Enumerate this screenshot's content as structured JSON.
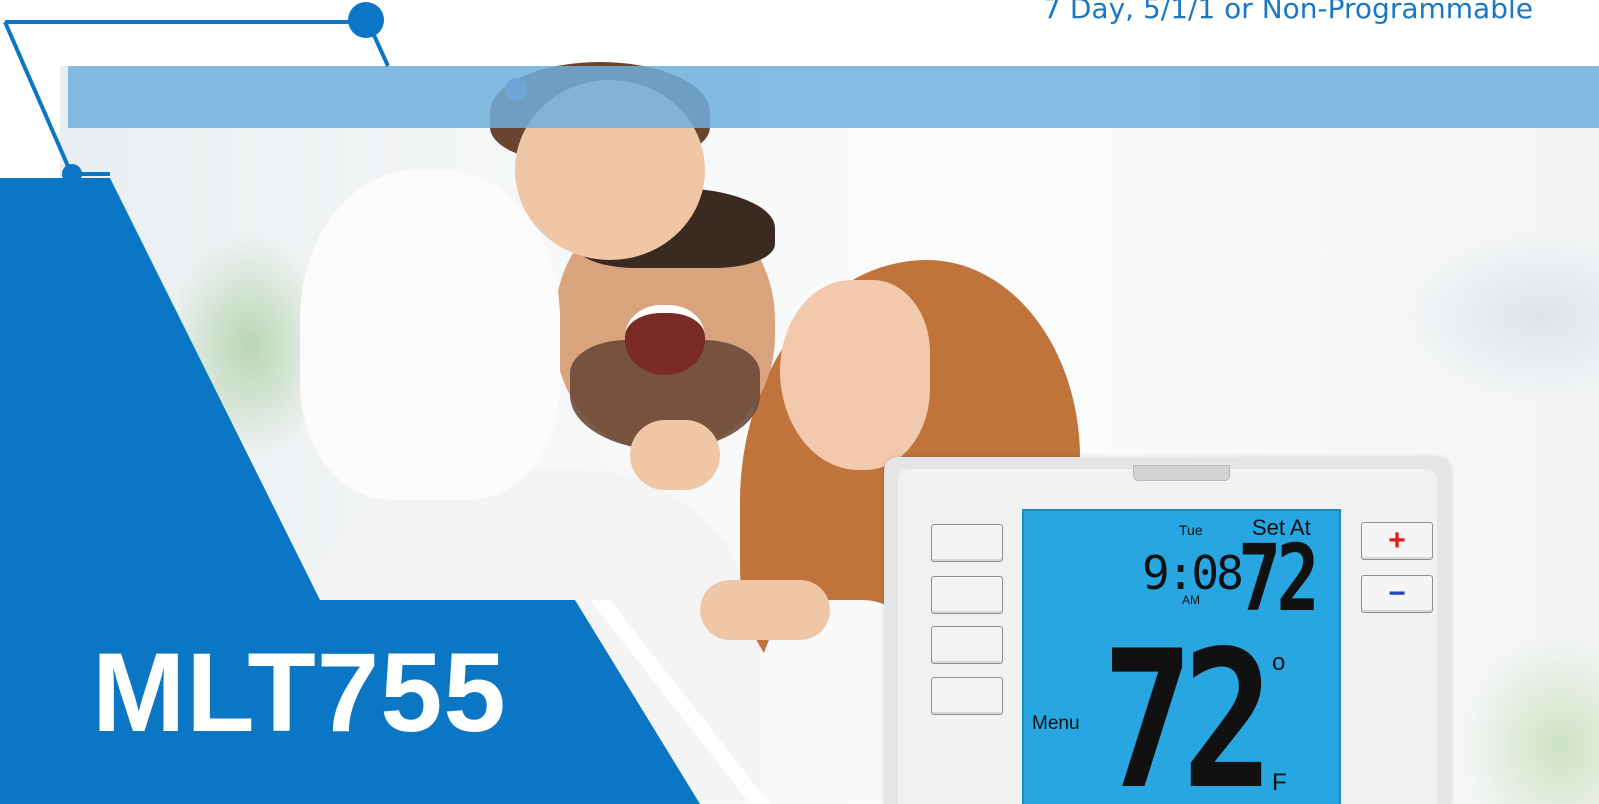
{
  "header": {
    "subtitle": "7 Day, 5/1/1 or Non-Programmable"
  },
  "product": {
    "model": "MLT755"
  },
  "thermostat": {
    "display": {
      "day": "Tue",
      "set_label": "Set At",
      "time": "9:08",
      "am_pm": "AM",
      "set_temperature": "72",
      "menu_label": "Menu",
      "current_temperature": "72",
      "degree_symbol": "o",
      "unit": "F"
    },
    "buttons": {
      "plus_label": "+",
      "minus_label": "−"
    }
  },
  "colors": {
    "brand_blue": "#0a76c4",
    "lcd_blue": "#27a6e1",
    "plus_red": "#e21d1d",
    "minus_blue": "#2a45b5"
  }
}
